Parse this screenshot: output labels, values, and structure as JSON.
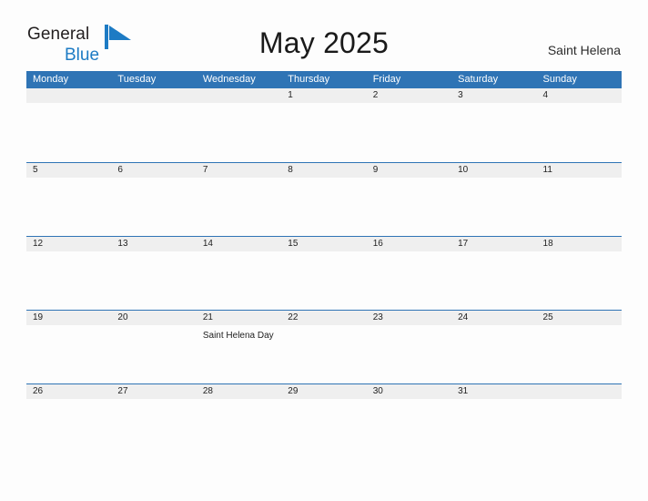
{
  "brand": {
    "word1": "General",
    "word2": "Blue",
    "flag_icon": "blue-flag-triangle-icon",
    "color_dark": "#231f20",
    "color_blue": "#1d7bc4"
  },
  "header": {
    "title": "May 2025",
    "region": "Saint Helena"
  },
  "theme": {
    "header_blue": "#2f74b5",
    "date_band_gray": "#efefef",
    "page_background": "#fdfdfd",
    "text_dark": "#222222"
  },
  "calendar": {
    "weekdays": [
      "Monday",
      "Tuesday",
      "Wednesday",
      "Thursday",
      "Friday",
      "Saturday",
      "Sunday"
    ],
    "weeks": [
      {
        "days": [
          {
            "date": "",
            "event": ""
          },
          {
            "date": "",
            "event": ""
          },
          {
            "date": "",
            "event": ""
          },
          {
            "date": "1",
            "event": ""
          },
          {
            "date": "2",
            "event": ""
          },
          {
            "date": "3",
            "event": ""
          },
          {
            "date": "4",
            "event": ""
          }
        ]
      },
      {
        "days": [
          {
            "date": "5",
            "event": ""
          },
          {
            "date": "6",
            "event": ""
          },
          {
            "date": "7",
            "event": ""
          },
          {
            "date": "8",
            "event": ""
          },
          {
            "date": "9",
            "event": ""
          },
          {
            "date": "10",
            "event": ""
          },
          {
            "date": "11",
            "event": ""
          }
        ]
      },
      {
        "days": [
          {
            "date": "12",
            "event": ""
          },
          {
            "date": "13",
            "event": ""
          },
          {
            "date": "14",
            "event": ""
          },
          {
            "date": "15",
            "event": ""
          },
          {
            "date": "16",
            "event": ""
          },
          {
            "date": "17",
            "event": ""
          },
          {
            "date": "18",
            "event": ""
          }
        ]
      },
      {
        "days": [
          {
            "date": "19",
            "event": ""
          },
          {
            "date": "20",
            "event": ""
          },
          {
            "date": "21",
            "event": "Saint Helena Day"
          },
          {
            "date": "22",
            "event": ""
          },
          {
            "date": "23",
            "event": ""
          },
          {
            "date": "24",
            "event": ""
          },
          {
            "date": "25",
            "event": ""
          }
        ]
      },
      {
        "days": [
          {
            "date": "26",
            "event": ""
          },
          {
            "date": "27",
            "event": ""
          },
          {
            "date": "28",
            "event": ""
          },
          {
            "date": "29",
            "event": ""
          },
          {
            "date": "30",
            "event": ""
          },
          {
            "date": "31",
            "event": ""
          },
          {
            "date": "",
            "event": ""
          }
        ]
      }
    ]
  }
}
